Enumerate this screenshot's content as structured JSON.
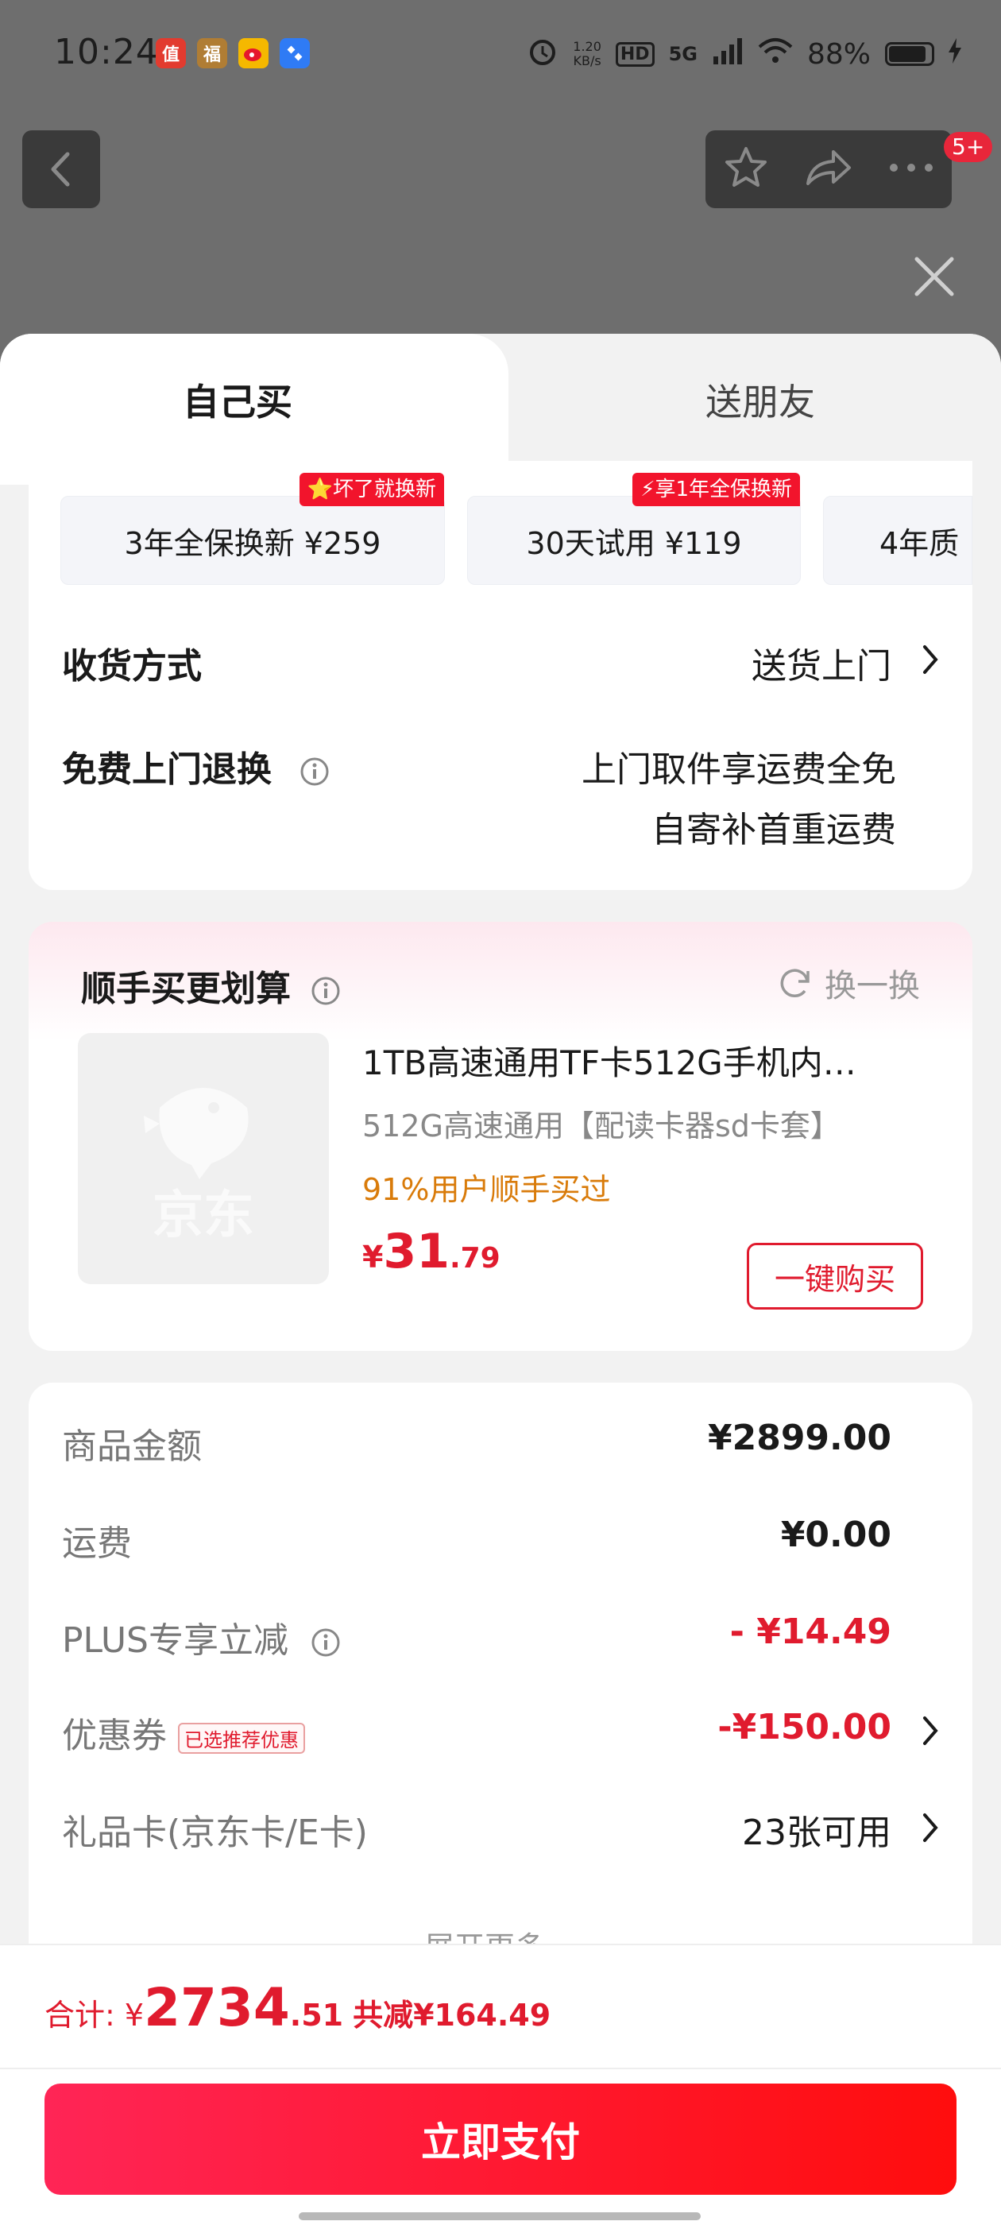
{
  "status_bar": {
    "time": "10:24",
    "speed_value": "1.20",
    "speed_unit": "KB/s",
    "hd": "HD",
    "network": "5G",
    "battery": "88%",
    "battery_level": 0.88,
    "app_icons": [
      "值",
      "福"
    ]
  },
  "nav": {
    "badge": "5+"
  },
  "tabs": [
    {
      "label": "自己买",
      "active": true
    },
    {
      "label": "送朋友",
      "active": false
    }
  ],
  "service_options": [
    {
      "label": "3年全保换新  ¥259",
      "tag": "⭐坏了就换新"
    },
    {
      "label": "30天试用  ¥119",
      "tag": "⚡享1年全保换新"
    },
    {
      "label": "4年质",
      "tag": ""
    }
  ],
  "delivery": {
    "label": "收货方式",
    "value": "送货上门"
  },
  "return_policy": {
    "label": "免费上门退换",
    "line1": "上门取件享运费全免",
    "line2": "自寄补首重运费"
  },
  "addon": {
    "title": "顺手买更划算",
    "refresh": "换一换",
    "thumb_text": "京东",
    "product_title": "1TB高速通用TF卡512G手机内…",
    "product_sub": "512G高速通用【配读卡器sd卡套】",
    "buyers": "91%用户顺手买过",
    "price_symbol": "¥",
    "price_int": "31",
    "price_dec": ".79",
    "buy_button": "一键购买"
  },
  "summary": {
    "goods_label": "商品金额",
    "goods_amount": "¥2899.00",
    "shipping_label": "运费",
    "shipping_amount": "¥0.00",
    "plus_label": "PLUS专享立减",
    "plus_amount": "- ¥14.49",
    "coupon_label": "优惠券",
    "coupon_tag": "已选推荐优惠",
    "coupon_amount": "-¥150.00",
    "giftcard_label": "礼品卡(京东卡/E卡)",
    "giftcard_value": "23张可用",
    "expand": "展开更多"
  },
  "footer": {
    "total_label": "合计: ¥",
    "total_int": "2734",
    "total_dec": ".51",
    "saved": "共减¥164.49",
    "pay_button": "立即支付"
  },
  "colors": {
    "accent_red": "#e01b2e",
    "pay_gradient_start": "#ff2556",
    "pay_gradient_end": "#ff0d0d",
    "buyers_orange": "#d97b0a"
  }
}
